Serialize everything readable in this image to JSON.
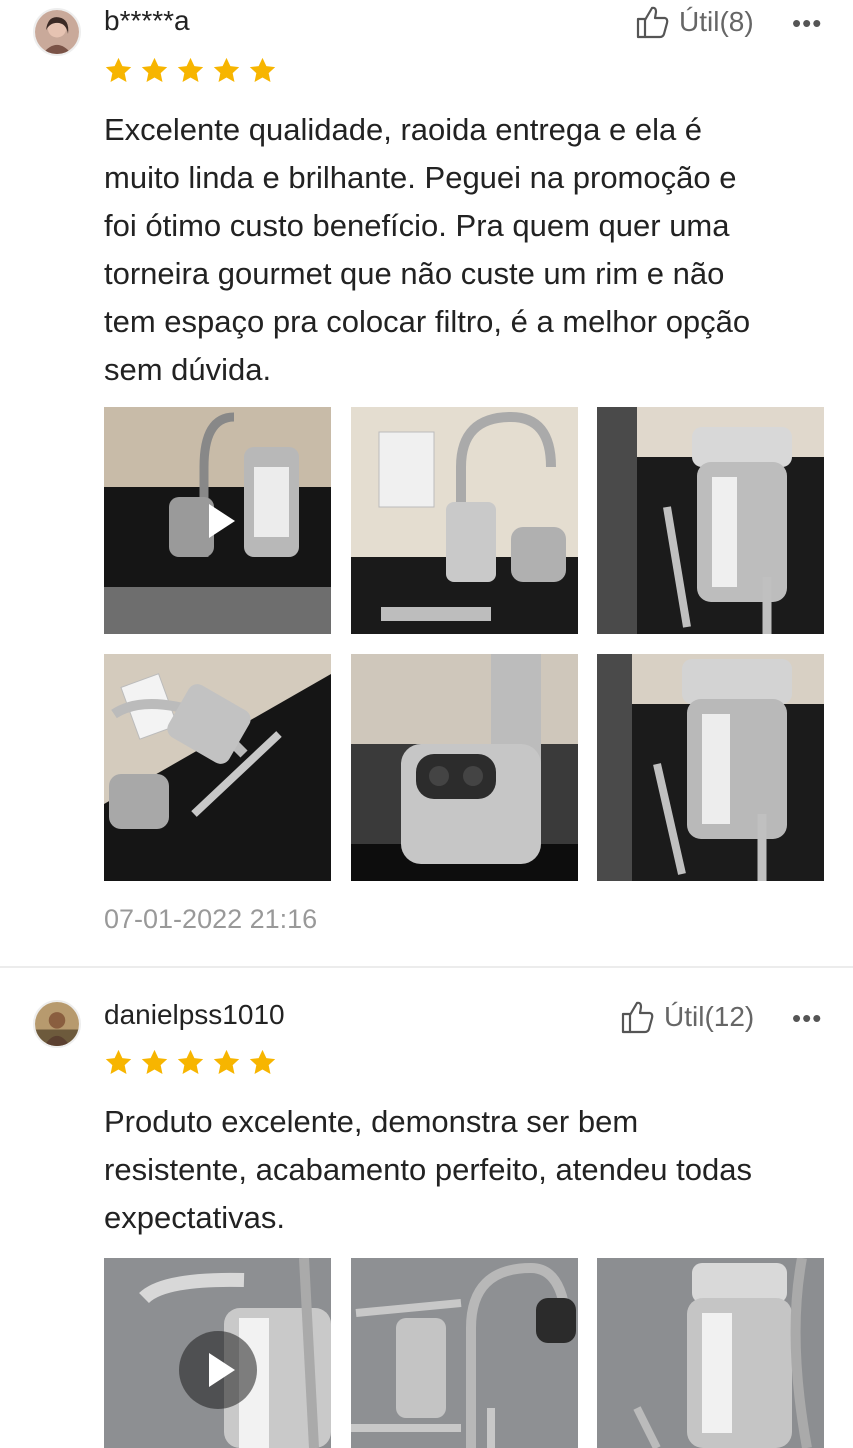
{
  "reviews": [
    {
      "username": "b*****a",
      "helpful_label": "Útil(8)",
      "more_label": "•••",
      "rating": 5,
      "text_lines": [
        "Excelente qualidade, raoida entrega e ela é",
        "muito linda e brilhante. Peguei na promoção e",
        "foi ótimo custo benefício. Pra quem quer uma",
        "torneira gourmet que não custe um rim e não",
        "tem espaço pra colocar filtro, é a melhor opção",
        "sem dúvida."
      ],
      "date": "07-01-2022 21:16"
    },
    {
      "username": "danielpss1010",
      "helpful_label": "Útil(12)",
      "more_label": "•••",
      "rating": 5,
      "text_lines": [
        "Produto excelente, demonstra ser bem",
        "resistente, acabamento perfeito, atendeu todas",
        "expectativas."
      ]
    }
  ],
  "colors": {
    "star": "#F7B500",
    "divider": "#ECECEC",
    "date": "#999999"
  },
  "icons": {
    "helpful": "thumbs-up-icon",
    "more": "more-icon",
    "star": "star-icon",
    "video": "play-icon"
  }
}
